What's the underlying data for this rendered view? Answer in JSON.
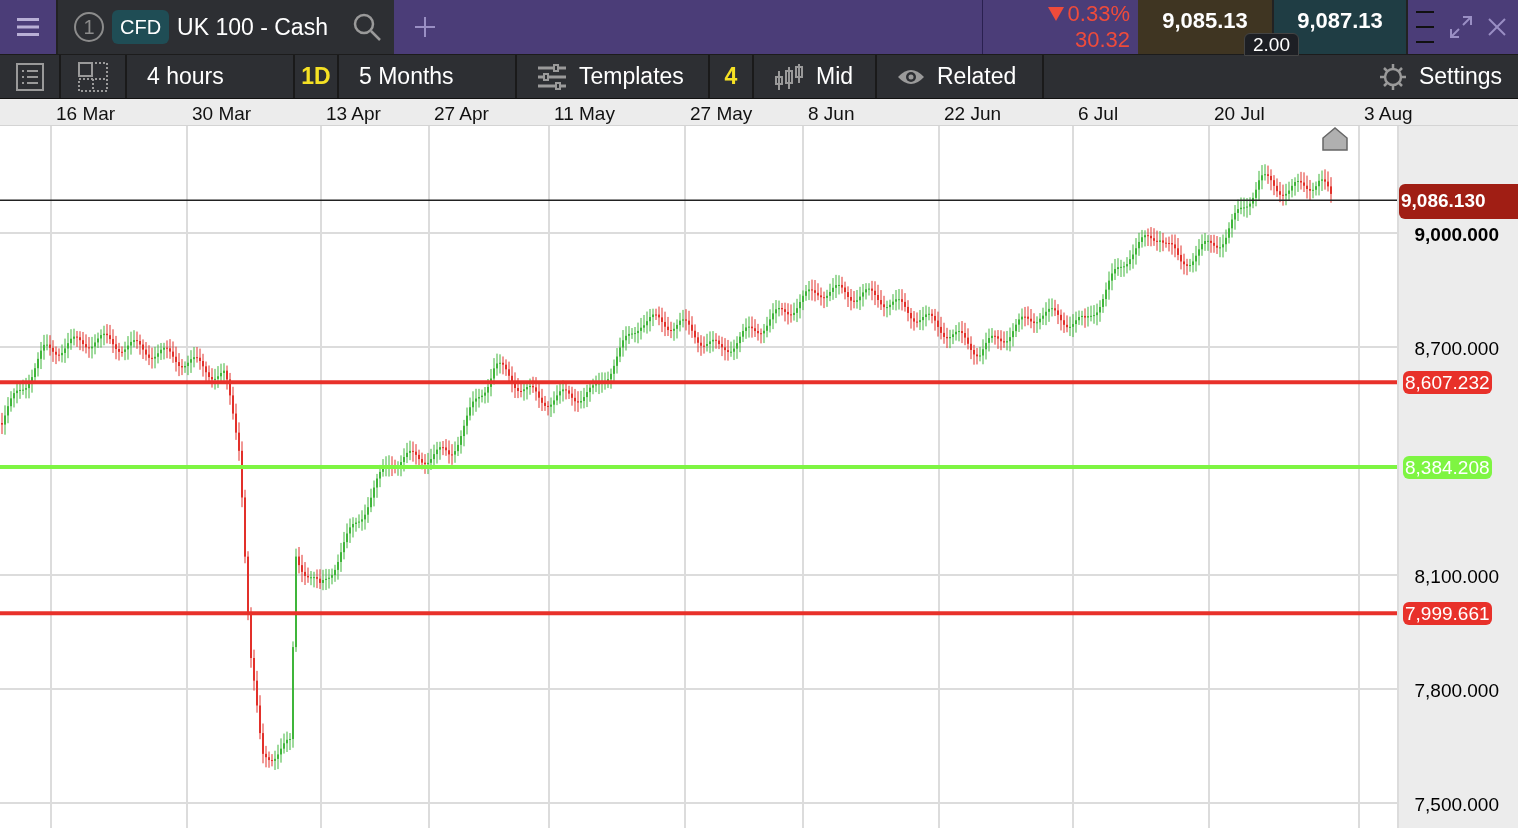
{
  "header": {
    "tab_number": "1",
    "instrument_type": "CFD",
    "instrument": "UK 100 - Cash"
  },
  "change": {
    "falling": true,
    "percent": "0.33%",
    "points": "30.32"
  },
  "quote": {
    "sell": "9,085.13",
    "buy": "9,087.13",
    "spread": "2.00"
  },
  "toolbar": [
    {
      "kind": "plain",
      "label": "4 hours"
    },
    {
      "kind": "highlight",
      "label": "1D"
    },
    {
      "kind": "plain",
      "label": "5 Months"
    },
    {
      "kind": "templates",
      "label": "Templates"
    },
    {
      "kind": "highlight",
      "label": "4"
    },
    {
      "kind": "mid",
      "label": "Mid"
    },
    {
      "kind": "related",
      "label": "Related"
    }
  ],
  "settings": {
    "label": "Settings"
  },
  "chart": {
    "dates": [
      "16 Mar",
      "30 Mar",
      "13 Apr",
      "27 Apr",
      "11 May",
      "27 May",
      "8 Jun",
      "22 Jun",
      "6 Jul",
      "20 Jul",
      "3 Aug"
    ],
    "yticks": [
      "9,000.000",
      "8,700.000",
      "8,100.000",
      "7,800.000",
      "7,500.000"
    ],
    "price_lines": [
      {
        "kind": "current",
        "value": "9,086.130",
        "color": "#a01e14"
      },
      {
        "kind": "level",
        "value": "8,607.232",
        "color": "#e8312a"
      },
      {
        "kind": "level",
        "value": "8,384.208",
        "color": "#7ef542"
      },
      {
        "kind": "level",
        "value": "7,999.661",
        "color": "#e8312a"
      }
    ]
  }
}
